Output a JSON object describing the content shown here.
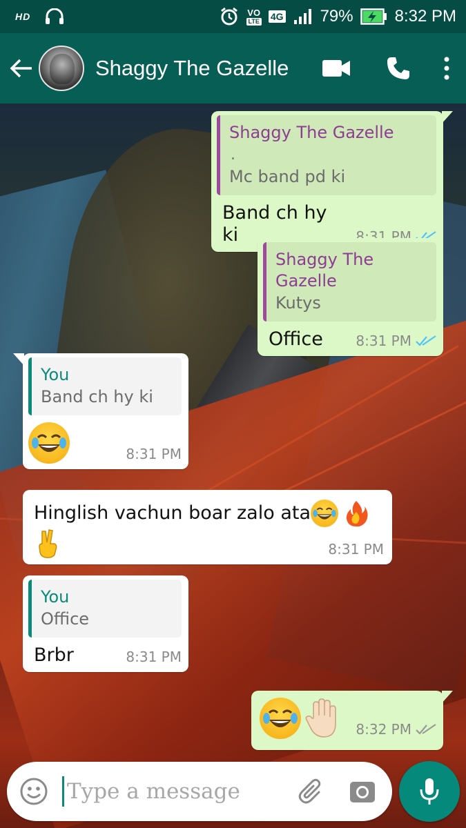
{
  "status_bar": {
    "hd": "HD",
    "volte_top": "VO",
    "volte_bottom": "LTE",
    "network": "4G",
    "battery": "79%",
    "time": "8:32 PM"
  },
  "header": {
    "contact_name": "Shaggy The Gazelle",
    "icons": [
      "back-arrow-icon",
      "video-call-icon",
      "voice-call-icon",
      "more-vert-icon"
    ]
  },
  "messages": [
    {
      "direction": "out",
      "quote_author": "Shaggy The Gazelle",
      "quote_dot": ".",
      "quote_text": "Mc band pd ki",
      "text": "Band ch hy ki",
      "time": "8:31 PM",
      "status": "read"
    },
    {
      "direction": "out",
      "quote_author": "Shaggy The Gazelle",
      "quote_text": "Kutys",
      "text": "Office",
      "time": "8:31 PM",
      "status": "read"
    },
    {
      "direction": "in",
      "quote_author": "You",
      "quote_text": "Band ch hy ki",
      "text": "😂",
      "time": "8:31 PM"
    },
    {
      "direction": "in",
      "text": "Hinglish vachun boar zalo ata😂🔥✌",
      "text_main": "Hinglish vachun boar zalo ata",
      "time": "8:31 PM"
    },
    {
      "direction": "in",
      "quote_author": "You",
      "quote_text": "Office",
      "text": "Brbr",
      "time": "8:31 PM"
    },
    {
      "direction": "out",
      "text": "😂✋",
      "time": "8:32 PM",
      "status": "delivered"
    }
  ],
  "composer": {
    "placeholder": "Type a message",
    "icons": [
      "emoji-icon",
      "attach-icon",
      "camera-icon",
      "mic-icon"
    ]
  },
  "colors": {
    "status_bar": "#054d44",
    "header": "#075e54",
    "outgoing_bubble": "#dcf8c6",
    "incoming_bubble": "#ffffff",
    "read_tick": "#4fc3f7",
    "accent": "#05897a",
    "quote_purple": "#8d3e93",
    "quote_teal": "#0b8a7a"
  }
}
